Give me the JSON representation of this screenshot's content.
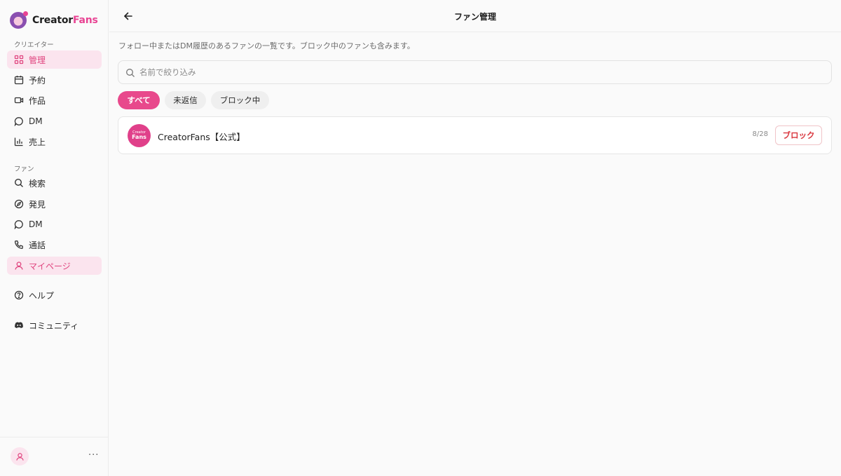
{
  "app": {
    "name_part1": "Creator",
    "name_part2": "Fans"
  },
  "sidebar": {
    "creator_section_label": "クリエイター",
    "creator_items": [
      {
        "label": "管理",
        "icon": "grid-icon",
        "active": true
      },
      {
        "label": "予約",
        "icon": "calendar-icon",
        "active": false
      },
      {
        "label": "作品",
        "icon": "video-icon",
        "active": false
      },
      {
        "label": "DM",
        "icon": "chat-bubble-icon",
        "active": false
      },
      {
        "label": "売上",
        "icon": "bar-chart-icon",
        "active": false
      }
    ],
    "fan_section_label": "ファン",
    "fan_items": [
      {
        "label": "検索",
        "icon": "search-icon",
        "active": false
      },
      {
        "label": "発見",
        "icon": "compass-icon",
        "active": false
      },
      {
        "label": "DM",
        "icon": "chat-bubble-icon",
        "active": false
      },
      {
        "label": "通話",
        "icon": "phone-icon",
        "active": false
      },
      {
        "label": "マイページ",
        "icon": "user-icon",
        "active": true
      }
    ],
    "help_label": "ヘルプ",
    "community_label": "コミュニティ",
    "more_label": "···"
  },
  "header": {
    "title": "ファン管理"
  },
  "main": {
    "description": "フォロー中またはDM履歴のあるファンの一覧です。ブロック中のファンも含みます。",
    "search_placeholder": "名前で絞り込み",
    "tabs": [
      {
        "label": "すべて",
        "active": true
      },
      {
        "label": "未返信",
        "active": false
      },
      {
        "label": "ブロック中",
        "active": false
      }
    ],
    "fans": [
      {
        "name": "CreatorFans【公式】",
        "avatar_line1": "Creator",
        "avatar_line2": "Fans",
        "date": "8/28",
        "action_label": "ブロック"
      }
    ]
  },
  "colors": {
    "accent": "#e8498c",
    "active_bg": "#fbe4ee",
    "danger": "#d9363e"
  }
}
